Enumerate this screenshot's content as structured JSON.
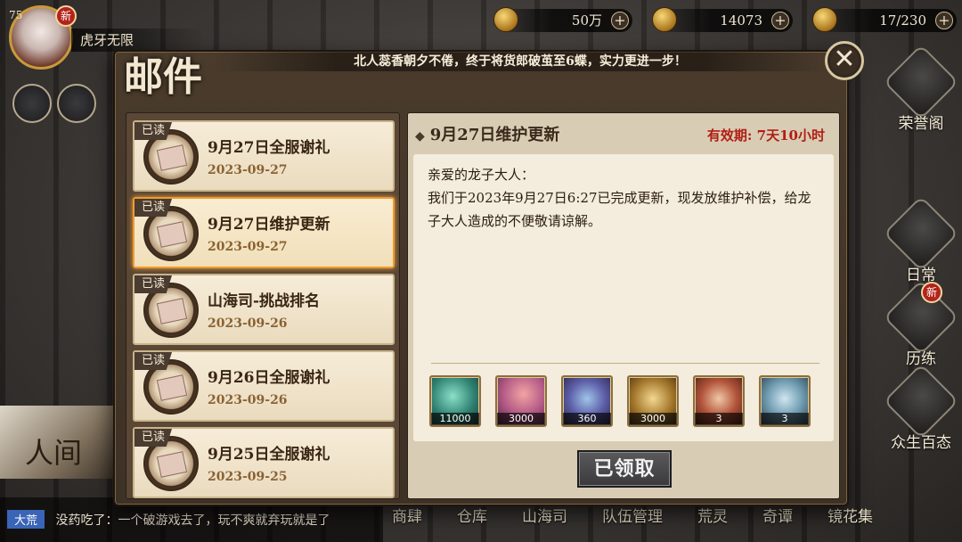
{
  "player": {
    "level": "75",
    "name": "虎牙无限",
    "new_badge": "新"
  },
  "resources": [
    {
      "icon": "coin-icon",
      "value": "50万"
    },
    {
      "icon": "jade-icon",
      "value": "14073"
    },
    {
      "icon": "stamina-icon",
      "value": "17/230"
    }
  ],
  "dialog": {
    "title": "邮件",
    "marquee": "北人蕊香朝夕不倦，终于将货郎破茧至6蝶，实力更进一步！",
    "close_symbol": "✕"
  },
  "mails": [
    {
      "tag": "已读",
      "title": "9月27日全服谢礼",
      "date": "2023-09-27"
    },
    {
      "tag": "已读",
      "title": "9月27日维护更新",
      "date": "2023-09-27"
    },
    {
      "tag": "已读",
      "title": "山海司-挑战排名",
      "date": "2023-09-26"
    },
    {
      "tag": "已读",
      "title": "9月26日全服谢礼",
      "date": "2023-09-26"
    },
    {
      "tag": "已读",
      "title": "9月25日全服谢礼",
      "date": "2023-09-25"
    }
  ],
  "detail": {
    "title": "9月27日维护更新",
    "validity": "有效期:  7天10小时",
    "greeting": "亲爱的龙子大人：",
    "body": "我们于2023年9月27日6:27已完成更新，现发放维护补偿，给龙子大人造成的不便敬请谅解。",
    "rewards": [
      {
        "icon": "green-gem-icon",
        "qty": "11000"
      },
      {
        "icon": "pink-crystal-icon",
        "qty": "3000"
      },
      {
        "icon": "blue-lantern-icon",
        "qty": "360"
      },
      {
        "icon": "gold-token-icon",
        "qty": "3000"
      },
      {
        "icon": "red-scroll-icon",
        "qty": "3"
      },
      {
        "icon": "blue-scroll-icon",
        "qty": "3"
      }
    ],
    "claim_button": "已领取"
  },
  "right_menu": [
    {
      "label": "荣誉阁"
    },
    {
      "label": "日常"
    },
    {
      "label": "历练",
      "badge": "新"
    },
    {
      "label": "众生百态"
    }
  ],
  "bottom_menu": [
    "商肆",
    "仓库",
    "山海司",
    "队伍管理",
    "荒灵",
    "奇谭",
    "镜花集"
  ],
  "chat": {
    "channel": "大荒",
    "text": "没药吃了：一个破游戏去了，玩不爽就弃玩就是了"
  },
  "event_banner": {
    "text": "人间"
  }
}
